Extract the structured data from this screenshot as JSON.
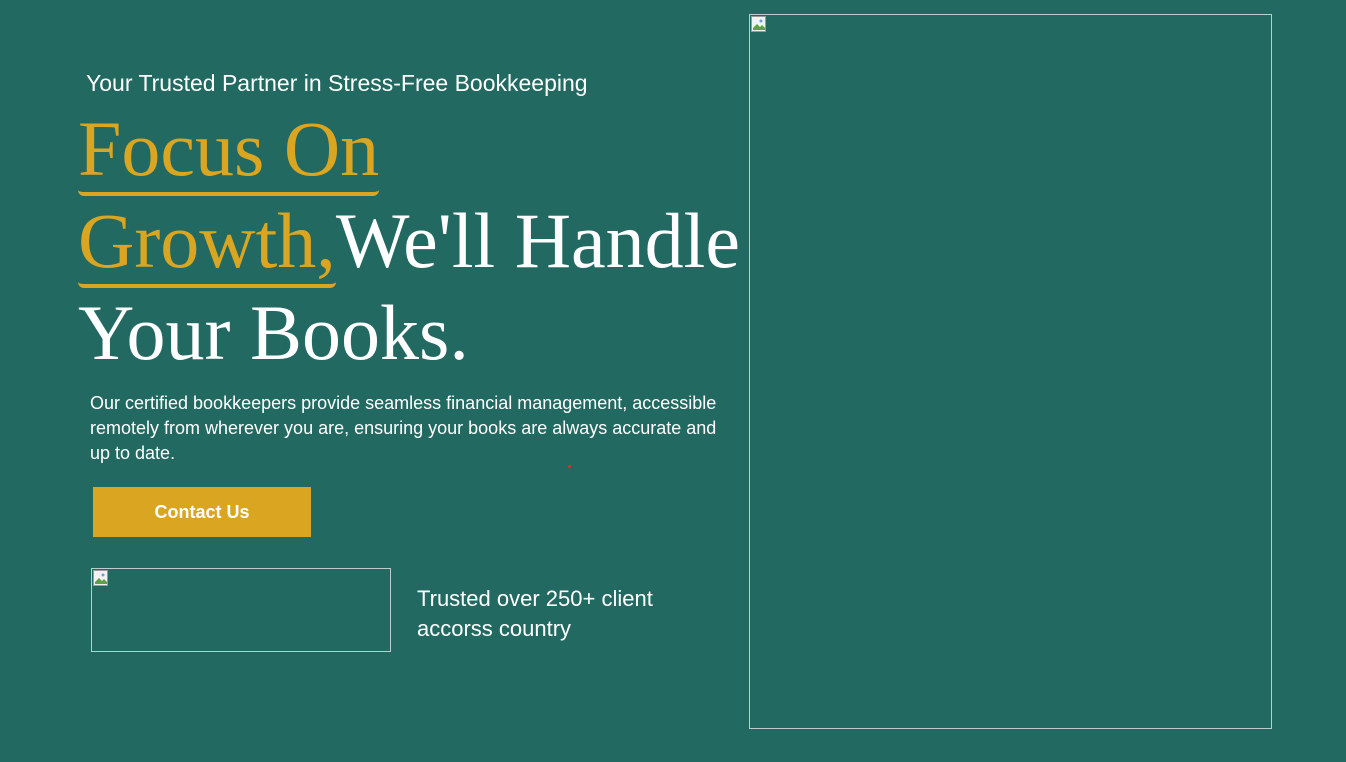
{
  "hero": {
    "tagline": "Your Trusted Partner in Stress-Free Bookkeeping",
    "headline_accent_1": "Focus On",
    "headline_accent_2": "Growth,",
    "headline_rest_1": "We'll Handle",
    "headline_rest_2": "Your Books.",
    "description": "Our certified bookkeepers provide seamless financial management, accessible remotely from wherever you are, ensuring your books are always accurate and up to date.",
    "cta_label": "Contact Us",
    "trust_text": "Trusted over 250+ client accorss country"
  },
  "colors": {
    "background": "#226961",
    "accent": "#daa521",
    "text": "#ffffff"
  },
  "icons": {
    "broken_image": "broken-image-icon"
  }
}
